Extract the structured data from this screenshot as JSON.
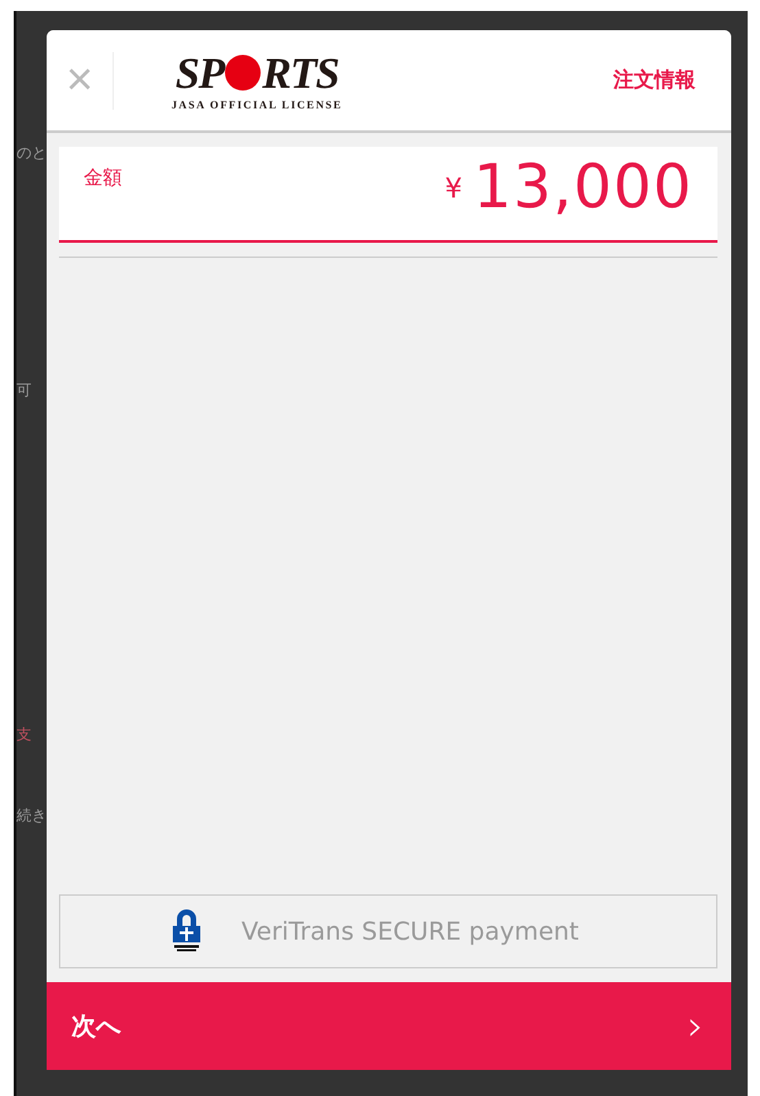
{
  "background_page": {
    "fragments": [
      "のと",
      "可",
      "支",
      "続き"
    ]
  },
  "modal": {
    "close_icon": "×",
    "logo": {
      "wordmark_left": "SP",
      "wordmark_right": "RTS",
      "tagline": "JASA OFFICIAL LICENSE"
    },
    "header_link": "注文情報",
    "amount": {
      "label": "金額",
      "currency": "¥",
      "value": "13,000"
    },
    "secure_badge": {
      "text": "VeriTrans SECURE payment"
    },
    "next_button": {
      "label": "次へ",
      "chevron": "›"
    }
  }
}
